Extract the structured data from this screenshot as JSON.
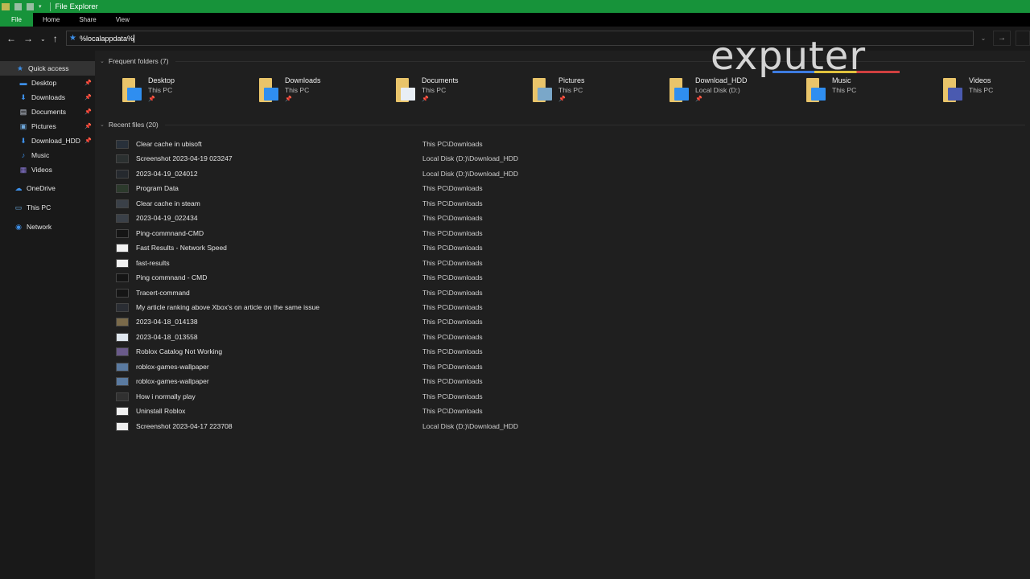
{
  "window": {
    "title": "File Explorer"
  },
  "ribbon": {
    "tabs": [
      "File",
      "Home",
      "Share",
      "View"
    ]
  },
  "address": {
    "value": "%localappdata%"
  },
  "sidebar": {
    "items": [
      {
        "label": "Quick access",
        "icon": "star-icon",
        "selected": true
      },
      {
        "label": "Desktop",
        "icon": "desktop-icon",
        "pinned": true
      },
      {
        "label": "Downloads",
        "icon": "download-icon",
        "pinned": true
      },
      {
        "label": "Documents",
        "icon": "documents-icon",
        "pinned": true
      },
      {
        "label": "Pictures",
        "icon": "pictures-icon",
        "pinned": true
      },
      {
        "label": "Download_HDD",
        "icon": "download-icon",
        "pinned": true
      },
      {
        "label": "Music",
        "icon": "music-icon"
      },
      {
        "label": "Videos",
        "icon": "videos-icon"
      },
      {
        "label": "OneDrive",
        "icon": "cloud-icon"
      },
      {
        "label": "This PC",
        "icon": "computer-icon"
      },
      {
        "label": "Network",
        "icon": "network-icon"
      }
    ]
  },
  "frequent": {
    "header": "Frequent folders (7)",
    "items": [
      {
        "name": "Desktop",
        "location": "This PC",
        "pinned": true
      },
      {
        "name": "Downloads",
        "location": "This PC",
        "pinned": true
      },
      {
        "name": "Documents",
        "location": "This PC",
        "pinned": true
      },
      {
        "name": "Pictures",
        "location": "This PC",
        "pinned": true
      },
      {
        "name": "Download_HDD",
        "location": "Local Disk (D:)",
        "pinned": true
      },
      {
        "name": "Music",
        "location": "This PC"
      },
      {
        "name": "Videos",
        "location": "This PC"
      }
    ]
  },
  "recent": {
    "header": "Recent files (20)",
    "items": [
      {
        "name": "Clear cache in ubisoft",
        "location": "This PC\\Downloads"
      },
      {
        "name": "Screenshot 2023-04-19 023247",
        "location": "Local Disk (D:)\\Download_HDD"
      },
      {
        "name": "2023-04-19_024012",
        "location": "Local Disk (D:)\\Download_HDD"
      },
      {
        "name": "Program Data",
        "location": "This PC\\Downloads"
      },
      {
        "name": "Clear cache in steam",
        "location": "This PC\\Downloads"
      },
      {
        "name": "2023-04-19_022434",
        "location": "This PC\\Downloads"
      },
      {
        "name": "Ping-commnand-CMD",
        "location": "This PC\\Downloads"
      },
      {
        "name": "Fast Results - Network Speed",
        "location": "This PC\\Downloads"
      },
      {
        "name": "fast-results",
        "location": "This PC\\Downloads"
      },
      {
        "name": "Ping commnand - CMD",
        "location": "This PC\\Downloads"
      },
      {
        "name": "Tracert-command",
        "location": "This PC\\Downloads"
      },
      {
        "name": "My article ranking above Xbox's on article on the same issue",
        "location": "This PC\\Downloads"
      },
      {
        "name": "2023-04-18_014138",
        "location": "This PC\\Downloads"
      },
      {
        "name": "2023-04-18_013558",
        "location": "This PC\\Downloads"
      },
      {
        "name": "Roblox Catalog Not Working",
        "location": "This PC\\Downloads"
      },
      {
        "name": "roblox-games-wallpaper",
        "location": "This PC\\Downloads"
      },
      {
        "name": "roblox-games-wallpaper",
        "location": "This PC\\Downloads"
      },
      {
        "name": "How i normally play",
        "location": "This PC\\Downloads"
      },
      {
        "name": "Uninstall Roblox",
        "location": "This PC\\Downloads"
      },
      {
        "name": "Screenshot 2023-04-17 223708",
        "location": "Local Disk (D:)\\Download_HDD"
      }
    ]
  },
  "watermark": "exputer",
  "colors": {
    "accent": "#17933a",
    "folder": "#e9c46a",
    "blue": "#3d8fe8"
  }
}
